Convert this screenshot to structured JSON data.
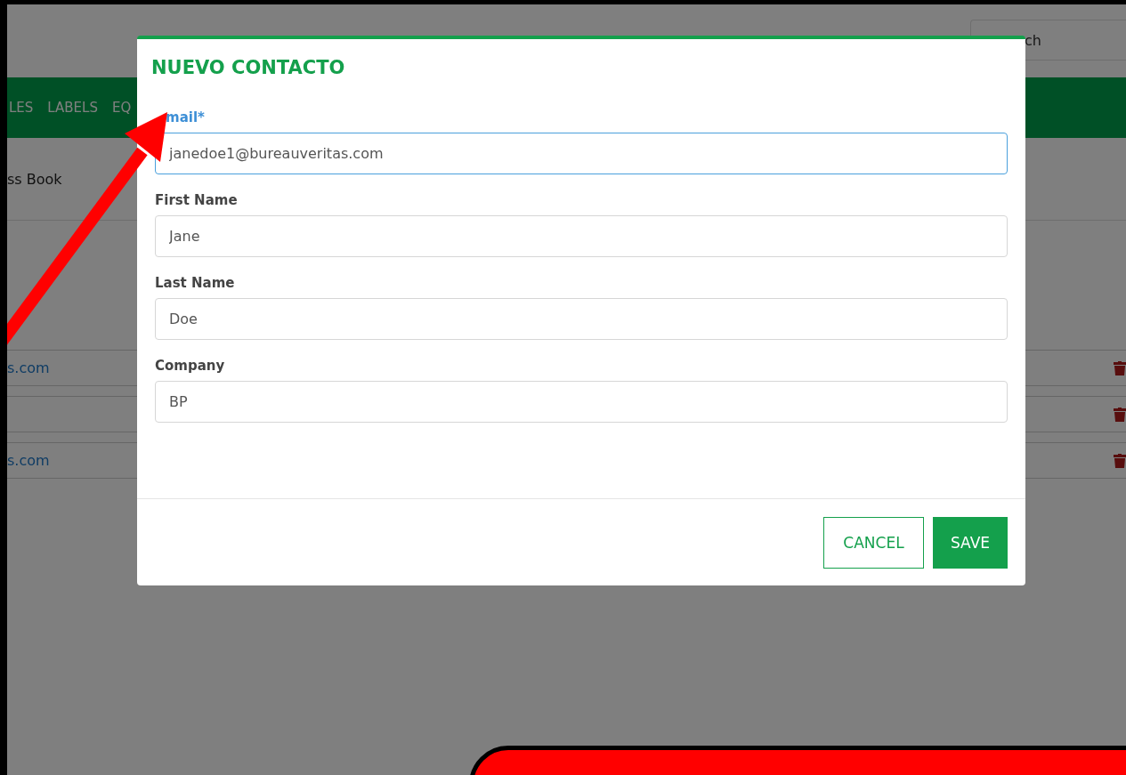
{
  "background": {
    "nav_items": [
      "LES",
      "LABELS",
      "EQ"
    ],
    "search": {
      "placeholder": "ch"
    },
    "breadcrumb": "ss Book",
    "rows": [
      {
        "kind": "link",
        "email": "s.com"
      },
      {
        "kind": "blank"
      },
      {
        "kind": "link",
        "email": "s.com"
      }
    ]
  },
  "modal": {
    "title": "NUEVO CONTACTO",
    "fields": [
      {
        "label": "mail*",
        "value": "janedoe1@bureauveritas.com",
        "focused": true
      },
      {
        "label": "First Name",
        "value": "Jane",
        "focused": false
      },
      {
        "label": "Last Name",
        "value": "Doe",
        "focused": false
      },
      {
        "label": "Company",
        "value": "BP",
        "focused": false
      }
    ],
    "buttons": [
      {
        "label": "CANCEL",
        "kind": "outline"
      },
      {
        "label": "SAVE",
        "kind": "primary"
      }
    ]
  }
}
